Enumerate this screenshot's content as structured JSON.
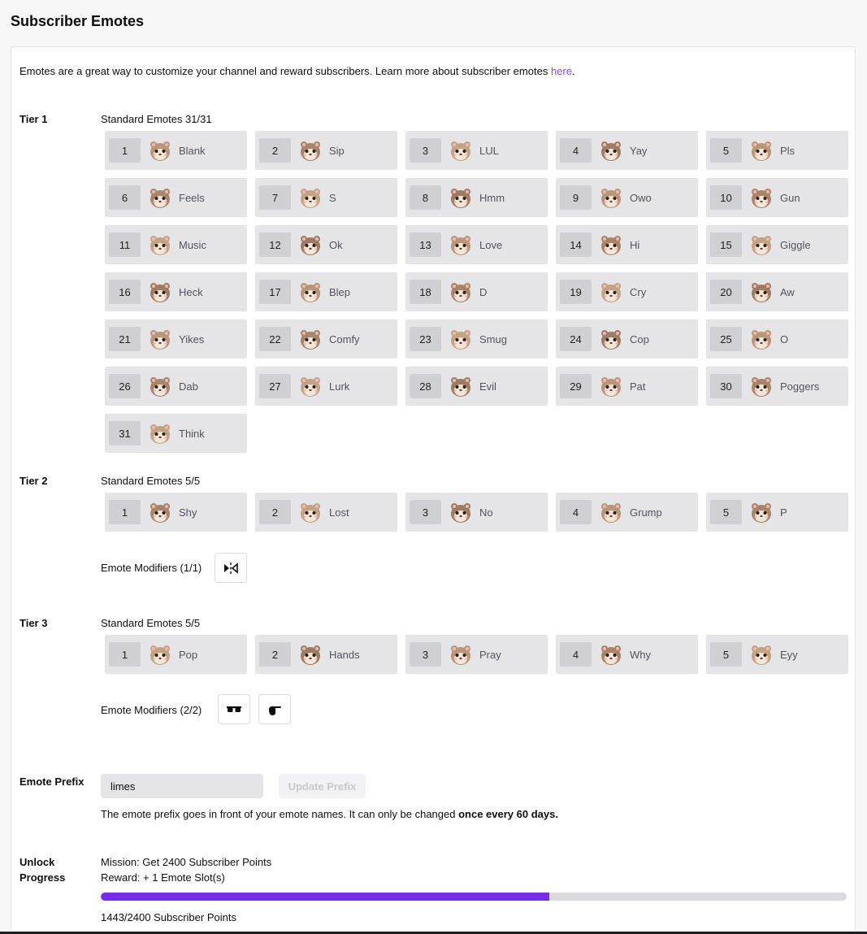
{
  "header": {
    "title": "Subscriber Emotes"
  },
  "intro": {
    "text": "Emotes are a great way to customize your channel and reward subscribers. Learn more about subscriber emotes ",
    "link": "here",
    "end": "."
  },
  "tiers": [
    {
      "label": "Tier 1",
      "standard_label": "Standard Emotes 31/31",
      "emotes": [
        {
          "num": "1",
          "name": "Blank"
        },
        {
          "num": "2",
          "name": "Sip"
        },
        {
          "num": "3",
          "name": "LUL"
        },
        {
          "num": "4",
          "name": "Yay"
        },
        {
          "num": "5",
          "name": "Pls"
        },
        {
          "num": "6",
          "name": "Feels"
        },
        {
          "num": "7",
          "name": "S"
        },
        {
          "num": "8",
          "name": "Hmm"
        },
        {
          "num": "9",
          "name": "Owo"
        },
        {
          "num": "10",
          "name": "Gun"
        },
        {
          "num": "11",
          "name": "Music"
        },
        {
          "num": "12",
          "name": "Ok"
        },
        {
          "num": "13",
          "name": "Love"
        },
        {
          "num": "14",
          "name": "Hi"
        },
        {
          "num": "15",
          "name": "Giggle"
        },
        {
          "num": "16",
          "name": "Heck"
        },
        {
          "num": "17",
          "name": "Blep"
        },
        {
          "num": "18",
          "name": "D"
        },
        {
          "num": "19",
          "name": "Cry"
        },
        {
          "num": "20",
          "name": "Aw"
        },
        {
          "num": "21",
          "name": "Yikes"
        },
        {
          "num": "22",
          "name": "Comfy"
        },
        {
          "num": "23",
          "name": "Smug"
        },
        {
          "num": "24",
          "name": "Cop"
        },
        {
          "num": "25",
          "name": "O"
        },
        {
          "num": "26",
          "name": "Dab"
        },
        {
          "num": "27",
          "name": "Lurk"
        },
        {
          "num": "28",
          "name": "Evil"
        },
        {
          "num": "29",
          "name": "Pat"
        },
        {
          "num": "30",
          "name": "Poggers"
        },
        {
          "num": "31",
          "name": "Think"
        }
      ]
    },
    {
      "label": "Tier 2",
      "standard_label": "Standard Emotes 5/5",
      "emotes": [
        {
          "num": "1",
          "name": "Shy"
        },
        {
          "num": "2",
          "name": "Lost"
        },
        {
          "num": "3",
          "name": "No"
        },
        {
          "num": "4",
          "name": "Grump"
        },
        {
          "num": "5",
          "name": "P"
        }
      ],
      "modifiers_label": "Emote Modifiers (1/1)",
      "modifiers": [
        "flip-icon"
      ]
    },
    {
      "label": "Tier 3",
      "standard_label": "Standard Emotes 5/5",
      "emotes": [
        {
          "num": "1",
          "name": "Pop"
        },
        {
          "num": "2",
          "name": "Hands"
        },
        {
          "num": "3",
          "name": "Pray"
        },
        {
          "num": "4",
          "name": "Why"
        },
        {
          "num": "5",
          "name": "Eyy"
        }
      ],
      "modifiers_label": "Emote Modifiers (2/2)",
      "modifiers": [
        "sunglasses-icon",
        "pointing-hand-icon"
      ]
    }
  ],
  "prefix": {
    "label": "Emote Prefix",
    "value": "limes",
    "button": "Update Prefix",
    "help_pre": "The emote prefix goes in front of your emote names. It can only be changed ",
    "help_bold": "once every 60 days."
  },
  "unlock": {
    "label_line1": "Unlock",
    "label_line2": "Progress",
    "mission": "Mission: Get 2400 Subscriber Points",
    "reward": "Reward: + 1 Emote Slot(s)",
    "progress_fraction": 0.6012,
    "progress_text": "1443/2400 Subscriber Points"
  },
  "colors": {
    "accent": "#9147ff",
    "progress": "#772ce8",
    "tile": "#e5e5e8"
  }
}
